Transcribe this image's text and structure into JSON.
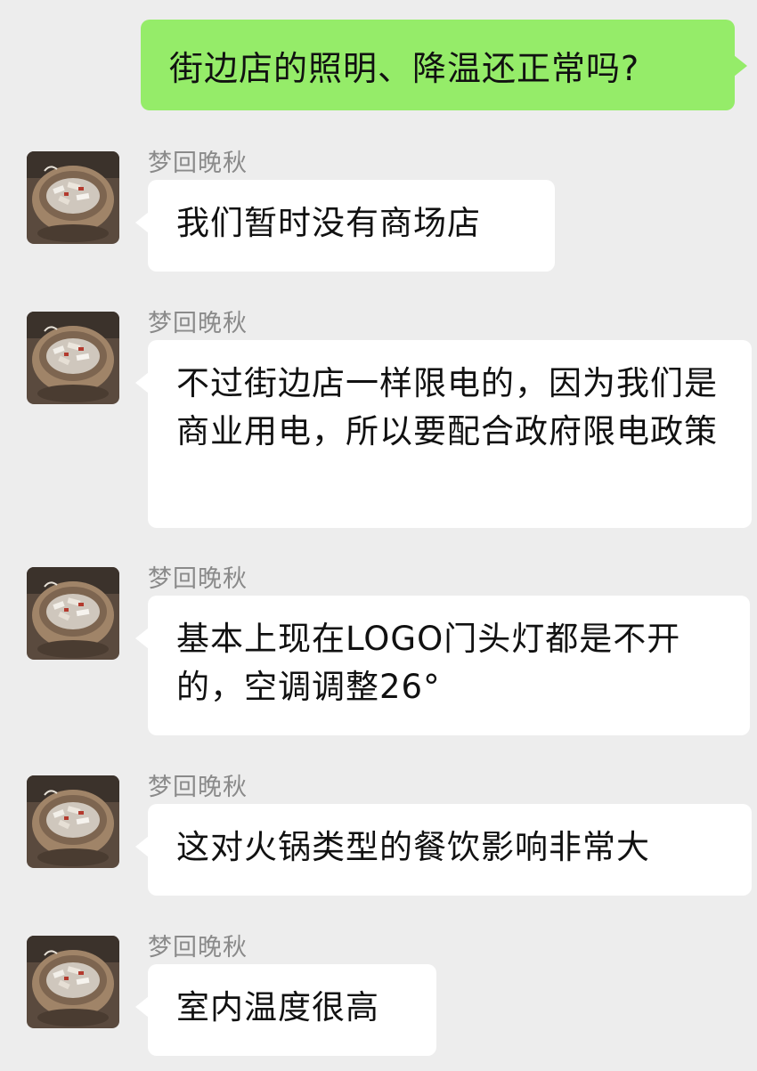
{
  "outgoing": {
    "text": "街边店的照明、降温还正常吗?"
  },
  "messages": [
    {
      "sender": "梦回晚秋",
      "text": "我们暂时没有商场店"
    },
    {
      "sender": "梦回晚秋",
      "text": "不过街边店一样限电的，因为我们是商业用电，所以要配合政府限电政策"
    },
    {
      "sender": "梦回晚秋",
      "text": "基本上现在LOGO门头灯都是不开的，空调调整26°"
    },
    {
      "sender": "梦回晚秋",
      "text": "这对火锅类型的餐饮影响非常大"
    },
    {
      "sender": "梦回晚秋",
      "text": "室内温度很高"
    }
  ],
  "colors": {
    "background": "#ededed",
    "outgoing_bubble": "#95ec69",
    "incoming_bubble": "#ffffff",
    "sender_name": "#8a8a8a"
  },
  "icons": {
    "avatar": "avatar-photo-hotpot"
  }
}
